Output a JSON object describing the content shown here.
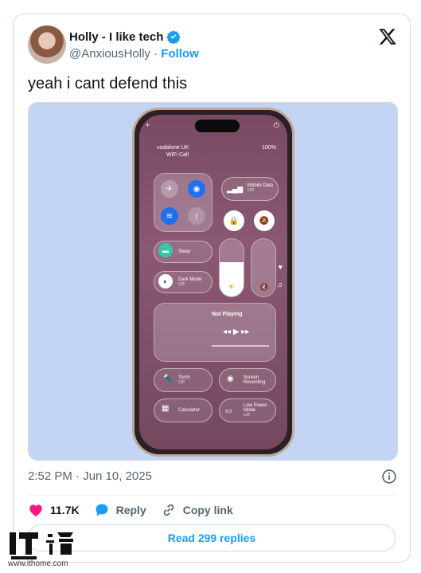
{
  "author": {
    "name": "Holly - I like tech",
    "handle": "@AnxiousHolly",
    "follow_label": "Follow"
  },
  "tweet": {
    "text": "yeah i cant defend this",
    "timestamp": "2:52 PM · Jun 10, 2025"
  },
  "phone": {
    "carrier": "vodafone UK",
    "wifi_call": "WiFi Call",
    "battery": "100%",
    "mobile_data_label": "Mobile Data",
    "mobile_data_state": "Off",
    "sleep_label": "Sleep",
    "dark_mode_label": "Dark Mode",
    "dark_mode_state": "Off",
    "now_playing": "Not Playing",
    "torch_label": "Torch",
    "torch_state": "Off",
    "screen_recording_label": "Screen Recording",
    "calculator_label": "Calculator",
    "low_power_label": "Low Power Mode",
    "low_power_state": "Off"
  },
  "actions": {
    "likes": "11.7K",
    "reply": "Reply",
    "copy_link": "Copy link",
    "read_replies": "Read 299 replies"
  },
  "watermark": {
    "url": "www.ithome.com"
  },
  "colors": {
    "accent": "#1d9bf0",
    "heart": "#f91880",
    "muted": "#536471",
    "media_bg": "#c4d5f3"
  }
}
